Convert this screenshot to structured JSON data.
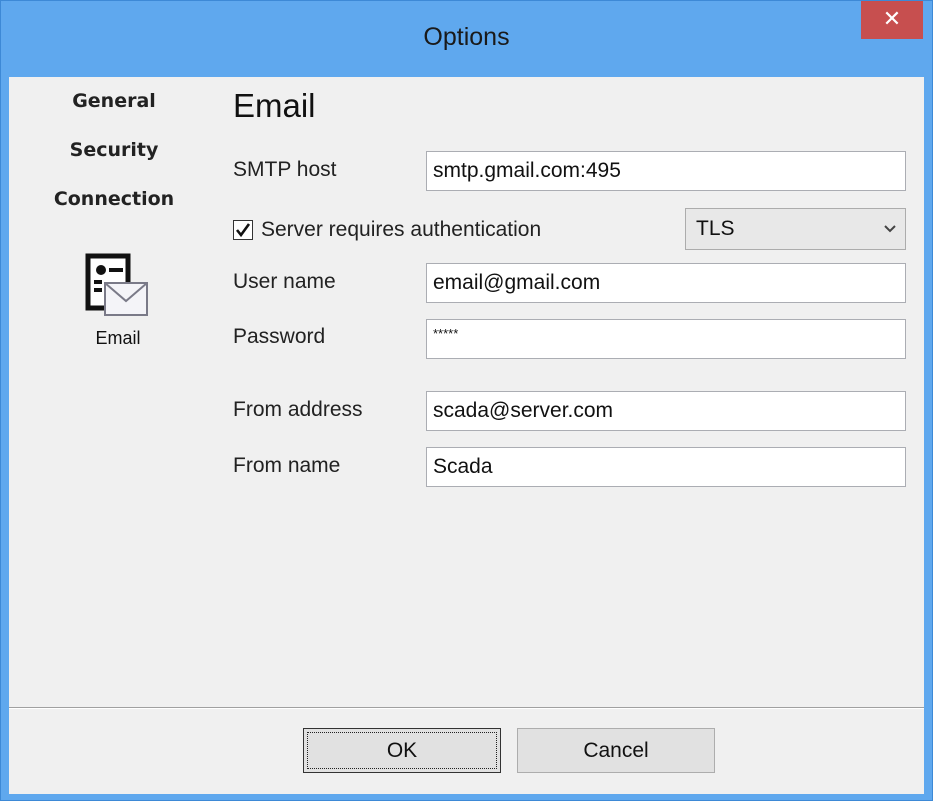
{
  "window": {
    "title": "Options",
    "close_glyph": "✕"
  },
  "sidebar": {
    "items": [
      {
        "label": "General"
      },
      {
        "label": "Security"
      },
      {
        "label": "Connection"
      },
      {
        "label": "Email",
        "icon": "email-settings-icon"
      }
    ]
  },
  "email": {
    "section_title": "Email",
    "smtp_host": {
      "label": "SMTP host",
      "value": "smtp.gmail.com:495"
    },
    "auth": {
      "label": "Server requires authentication",
      "checked": true
    },
    "encryption": {
      "selected": "TLS"
    },
    "user_name": {
      "label": "User name",
      "value": "email@gmail.com"
    },
    "password": {
      "label": "Password",
      "value": "*****"
    },
    "from_address": {
      "label": "From address",
      "value": "scada@server.com"
    },
    "from_name": {
      "label": "From name",
      "value": "Scada"
    }
  },
  "buttons": {
    "ok": "OK",
    "cancel": "Cancel"
  },
  "colors": {
    "titlebar": "#5fa8ee",
    "close": "#c74f4f",
    "client": "#f0f0f0"
  }
}
